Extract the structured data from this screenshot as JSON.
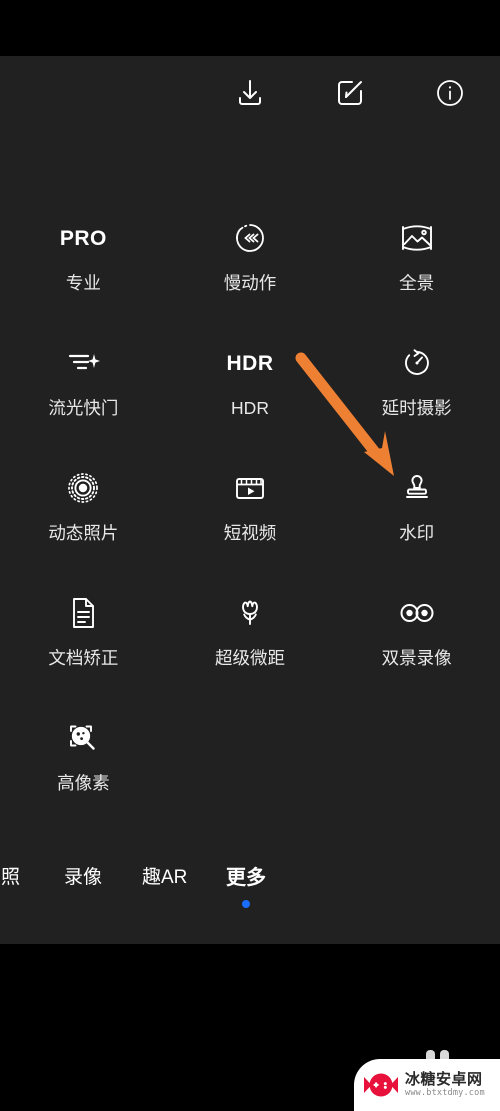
{
  "app": {
    "name": "camera-more-modes",
    "background_color": "#000000",
    "panel_color": "#212121",
    "accent_color": "#1a6dff",
    "annotation_color": "#ee8033"
  },
  "top_actions": [
    {
      "name": "download",
      "icon": "download-icon"
    },
    {
      "name": "edit",
      "icon": "edit-square-pen-icon"
    },
    {
      "name": "info",
      "icon": "info-circle-icon"
    }
  ],
  "modes": {
    "rows": [
      [
        {
          "label": "专业",
          "icon": "pro-text-icon",
          "icon_text": "PRO"
        },
        {
          "label": "慢动作",
          "icon": "slow-motion-icon",
          "icon_text": ""
        },
        {
          "label": "全景",
          "icon": "panorama-icon",
          "icon_text": ""
        }
      ],
      [
        {
          "label": "流光快门",
          "icon": "light-painting-icon",
          "icon_text": ""
        },
        {
          "label": "HDR",
          "icon": "hdr-text-icon",
          "icon_text": "HDR"
        },
        {
          "label": "延时摄影",
          "icon": "time-lapse-icon",
          "icon_text": ""
        }
      ],
      [
        {
          "label": "动态照片",
          "icon": "live-photo-icon",
          "icon_text": ""
        },
        {
          "label": "短视频",
          "icon": "short-video-icon",
          "icon_text": ""
        },
        {
          "label": "水印",
          "icon": "watermark-stamp-icon",
          "icon_text": ""
        }
      ],
      [
        {
          "label": "文档矫正",
          "icon": "document-correction-icon",
          "icon_text": ""
        },
        {
          "label": "超级微距",
          "icon": "super-macro-flower-icon",
          "icon_text": ""
        },
        {
          "label": "双景录像",
          "icon": "dual-view-video-icon",
          "icon_text": ""
        }
      ],
      [
        {
          "label": "高像素",
          "icon": "high-resolution-icon",
          "icon_text": ""
        },
        {
          "label": "",
          "icon": "",
          "icon_text": ""
        },
        {
          "label": "",
          "icon": "",
          "icon_text": ""
        }
      ]
    ]
  },
  "tabs": [
    {
      "label": "拍照",
      "active": false
    },
    {
      "label": "录像",
      "active": false
    },
    {
      "label": "趣AR",
      "active": false
    },
    {
      "label": "更多",
      "active": true
    }
  ],
  "annotation": {
    "type": "arrow",
    "points_to": "水印",
    "color": "#ee8033"
  },
  "watermark": {
    "title": "冰糖安卓网",
    "url": "www.btxtdmy.com",
    "logo_color": "#e8113c"
  }
}
